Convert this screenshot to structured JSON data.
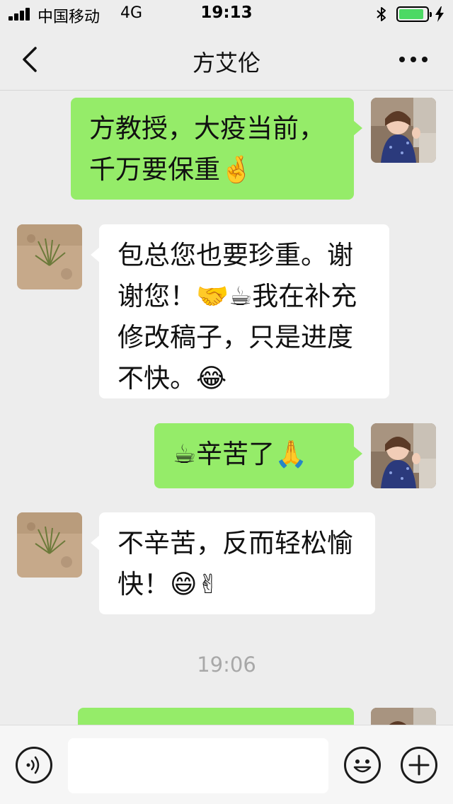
{
  "status_bar": {
    "carrier": "中国移动",
    "network": "4G",
    "time": "19:13",
    "icons": [
      "signal-icon",
      "bluetooth-icon",
      "battery-icon",
      "charging-icon"
    ],
    "battery_color": "#4cd964"
  },
  "nav": {
    "title": "方艾伦",
    "back_icon": "chevron-left-icon",
    "more_icon": "more-dots-icon"
  },
  "messages": [
    {
      "direction": "outgoing",
      "text": "方教授，大疫当前，千万要保重🤞"
    },
    {
      "direction": "incoming",
      "text": "包总您也要珍重。谢谢您！🤝☕我在补充修改稿子，只是进度不快。😂"
    },
    {
      "direction": "outgoing",
      "text": "☕辛苦了🙏"
    },
    {
      "direction": "incoming",
      "text": "不辛苦，反而轻松愉快！😄✌"
    },
    {
      "direction": "outgoing",
      "text": ""
    }
  ],
  "timestamp": "19:06",
  "input_bar": {
    "voice_icon": "voice-icon",
    "emoji_icon": "emoji-icon",
    "plus_icon": "plus-icon",
    "placeholder": ""
  },
  "colors": {
    "background": "#ededed",
    "outgoing_bubble": "#95ec69",
    "incoming_bubble": "#ffffff",
    "timestamp_text": "#a8a8a8"
  }
}
